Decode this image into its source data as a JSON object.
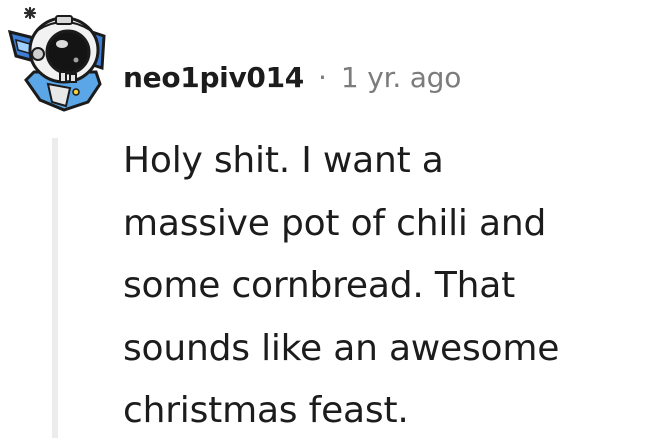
{
  "comment": {
    "username": "neo1piv014",
    "separator": "·",
    "timestamp": "1 yr. ago",
    "avatar_icon": "astronaut-avatar-icon",
    "body_lines": [
      "Holy shit. I want a",
      "massive pot of chili and",
      "some cornbread. That",
      "sounds like an awesome",
      "christmas feast."
    ]
  },
  "colors": {
    "text": "#1c1c1c",
    "meta": "#7c7c7c",
    "thread_line": "#ececec",
    "avatar_blue": "#3a7bd5"
  }
}
